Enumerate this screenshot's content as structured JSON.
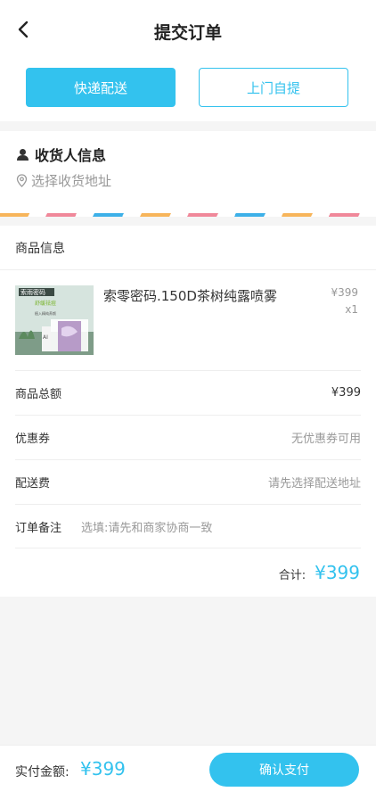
{
  "header": {
    "title": "提交订单"
  },
  "delivery_tabs": [
    {
      "label": "快递配送",
      "active": true
    },
    {
      "label": "上门自提",
      "active": false
    }
  ],
  "address": {
    "title": "收货人信息",
    "placeholder": "选择收货地址"
  },
  "goods": {
    "section_title": "商品信息",
    "items": [
      {
        "name": "索零密码.150D茶树纯露喷雾",
        "price": "¥399",
        "qty": "x1",
        "image_text": [
          "索雨密码",
          "舒缓祛痘",
          "植入精纯养颜",
          "AI"
        ]
      }
    ]
  },
  "summary": {
    "subtotal_label": "商品总额",
    "subtotal_value": "¥399",
    "coupon_label": "优惠券",
    "coupon_value": "无优惠券可用",
    "shipping_label": "配送费",
    "shipping_value": "请先选择配送地址",
    "note_label": "订单备注",
    "note_placeholder": "选填:请先和商家协商一致",
    "total_label": "合计:",
    "total_value": "¥399"
  },
  "footer": {
    "pay_label": "实付金额:",
    "pay_value": "¥399",
    "confirm_label": "确认支付"
  },
  "colors": {
    "accent": "#33c2ee"
  }
}
